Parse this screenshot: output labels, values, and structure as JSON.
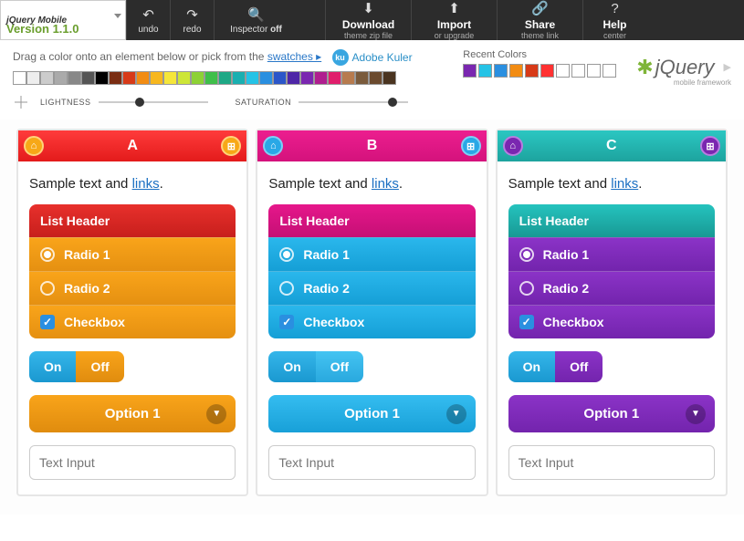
{
  "topbar": {
    "product": "jQuery Mobile",
    "version": "Version 1.1.0",
    "undo": "undo",
    "redo": "redo",
    "inspector_pre": "Inspector ",
    "inspector_state": "off",
    "download": {
      "t": "Download",
      "s": "theme zip file"
    },
    "import": {
      "t": "Import",
      "s": "or upgrade"
    },
    "share": {
      "t": "Share",
      "s": "theme link"
    },
    "help": {
      "t": "Help",
      "s": "center"
    }
  },
  "sub": {
    "hint_pre": "Drag a color onto an element below or pick from the ",
    "hint_link": "swatches ▸",
    "kuler": "Adobe Kuler",
    "recent": "Recent Colors",
    "logo": "jQuery",
    "logo_sub": "mobile framework"
  },
  "pal": [
    "#ffffff",
    "#eeeeee",
    "#cccccc",
    "#aaaaaa",
    "#888888",
    "#555555",
    "#000000",
    "#7a2d12",
    "#d73a18",
    "#f28c13",
    "#f7b71e",
    "#f5e63a",
    "#cde637",
    "#8dd135",
    "#3fbf4a",
    "#1ea885",
    "#1aafb0",
    "#25c3e6",
    "#2a8fe0",
    "#2b56c9",
    "#4e26a7",
    "#7a27b0",
    "#b01e8f",
    "#e01e6c",
    "#b77b4e",
    "#7a5b3c",
    "#6b4a2e",
    "#4a3420"
  ],
  "recent_pal": [
    "#7a27b0",
    "#25c3e6",
    "#2a8fe0",
    "#f28c13",
    "#d73a18",
    "#ff3131",
    "",
    "",
    "",
    ""
  ],
  "sliders": {
    "light": "LIGHTNESS",
    "sat": "SATURATION"
  },
  "themes": [
    {
      "letter": "A",
      "header_cls": "th-a",
      "ic_home": "home-a",
      "ic_grid": "grid-a",
      "lh": "lh-a",
      "li": "li-a",
      "sel": "sel-a",
      "on": "on-a",
      "off": "off-a"
    },
    {
      "letter": "B",
      "header_cls": "th-b",
      "ic_home": "home-b",
      "ic_grid": "grid-b",
      "lh": "lh-b",
      "li": "li-b",
      "sel": "sel-b",
      "on": "on-b",
      "off": "off-b"
    },
    {
      "letter": "C",
      "header_cls": "th-c",
      "ic_home": "home-c",
      "ic_grid": "grid-c",
      "lh": "lh-c",
      "li": "li-c",
      "sel": "sel-c",
      "on": "on-c",
      "off": "off-c"
    }
  ],
  "theme_body": {
    "sample_pre": "Sample text and ",
    "sample_link": "links",
    "sample_post": ".",
    "list_header": "List Header",
    "radio1": "Radio 1",
    "radio2": "Radio 2",
    "checkbox": "Checkbox",
    "on": "On",
    "off": "Off",
    "option": "Option 1",
    "input_ph": "Text Input"
  }
}
